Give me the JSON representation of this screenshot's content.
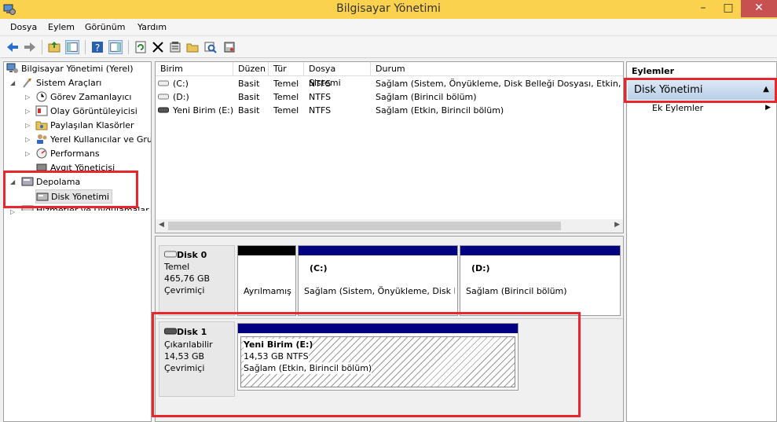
{
  "window": {
    "title": "Bilgisayar Yönetimi",
    "minimize": "–",
    "maximize": "□",
    "close": "✕"
  },
  "menu": [
    "Dosya",
    "Eylem",
    "Görünüm",
    "Yardım"
  ],
  "tree": {
    "root": "Bilgisayar Yönetimi (Yerel)",
    "system_tools": "Sistem Araçları",
    "task_scheduler": "Görev Zamanlayıcı",
    "event_viewer": "Olay Görüntüleyicisi",
    "shared_folders": "Paylaşılan Klasörler",
    "local_users": "Yerel Kullanıcılar ve Gru",
    "performance": "Performans",
    "device_manager": "Aygıt Yöneticisi",
    "storage": "Depolama",
    "disk_management": "Disk Yönetimi",
    "services": "Hizmetler ve Uygulamalar"
  },
  "volume_table": {
    "headers": [
      "Birim",
      "Düzen",
      "Tür",
      "Dosya Sistemi",
      "Durum"
    ],
    "rows": [
      [
        "(C:)",
        "Basit",
        "Temel",
        "NTFS",
        "Sağlam (Sistem, Önyükleme, Disk Belleği Dosyası, Etkin, Kilit"
      ],
      [
        "(D:)",
        "Basit",
        "Temel",
        "NTFS",
        "Sağlam (Birincil bölüm)"
      ],
      [
        "Yeni Birim (E:)",
        "Basit",
        "Temel",
        "NTFS",
        "Sağlam (Etkin, Birincil bölüm)"
      ]
    ]
  },
  "disks": {
    "disk0": {
      "name": "Disk 0",
      "type": "Temel",
      "size": "465,76 GB",
      "status": "Çevrimiçi",
      "reserved": "Ayrılmamış",
      "c_title": "(C:)",
      "c_desc": "Sağlam (Sistem, Önyükleme, Disk Be",
      "d_title": "(D:)",
      "d_desc": "Sağlam (Birincil bölüm)"
    },
    "disk1": {
      "name": "Disk 1",
      "type": "Çıkarılabilir",
      "size": "14,53 GB",
      "status": "Çevrimiçi",
      "vol_title": "Yeni Birim  (E:)",
      "vol_size": "14,53 GB NTFS",
      "vol_desc": "Sağlam (Etkin, Birincil bölüm)"
    }
  },
  "actions": {
    "header": "Eylemler",
    "section": "Disk Yönetimi",
    "more": "Ek Eylemler"
  },
  "colors": {
    "titlebar": "#fbd24d",
    "primary_partition": "#000080",
    "unallocated": "#000000",
    "highlight": "#e8262d"
  }
}
